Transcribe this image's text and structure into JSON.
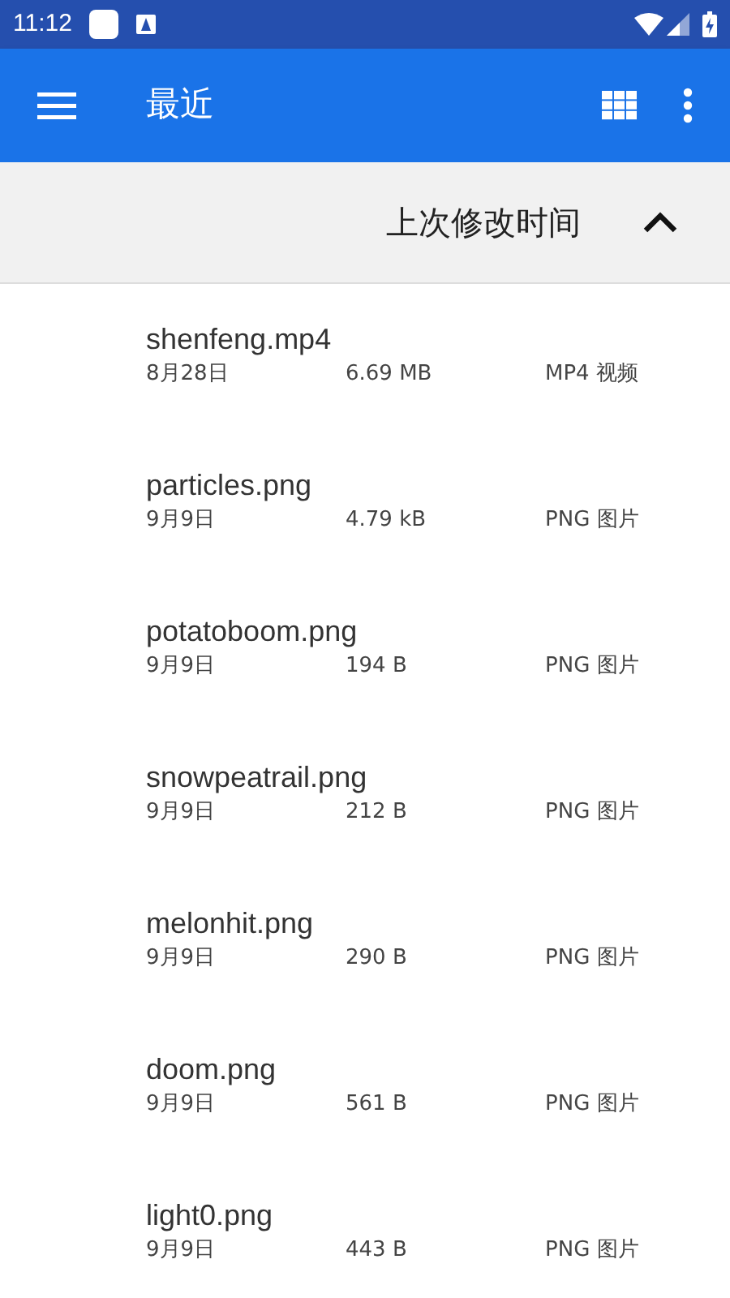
{
  "status_bar": {
    "time": "11:12"
  },
  "toolbar": {
    "title": "最近"
  },
  "sort_header": {
    "label": "上次修改时间",
    "ascending": true
  },
  "files": [
    {
      "name": "shenfeng.mp4",
      "date": "8月28日",
      "size": "6.69 MB",
      "type": "MP4 视频"
    },
    {
      "name": "particles.png",
      "date": "9月9日",
      "size": "4.79 kB",
      "type": "PNG 图片"
    },
    {
      "name": "potatoboom.png",
      "date": "9月9日",
      "size": "194 B",
      "type": "PNG 图片"
    },
    {
      "name": "snowpeatrail.png",
      "date": "9月9日",
      "size": "212 B",
      "type": "PNG 图片"
    },
    {
      "name": "melonhit.png",
      "date": "9月9日",
      "size": "290 B",
      "type": "PNG 图片"
    },
    {
      "name": "doom.png",
      "date": "9月9日",
      "size": "561 B",
      "type": "PNG 图片"
    },
    {
      "name": "light0.png",
      "date": "9月9日",
      "size": "443 B",
      "type": "PNG 图片"
    }
  ]
}
